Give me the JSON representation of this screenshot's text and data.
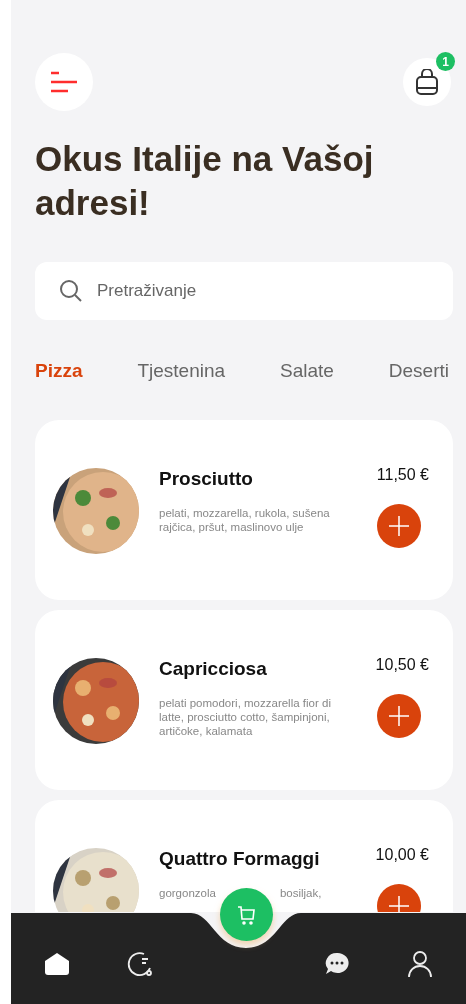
{
  "header": {
    "cart_count": "1"
  },
  "title": "Okus Italije na Vašoj adresi!",
  "search": {
    "placeholder": "Pretraživanje"
  },
  "tabs": [
    {
      "label": "Pizza",
      "selected": true
    },
    {
      "label": "Tjestenina",
      "selected": false
    },
    {
      "label": "Salate",
      "selected": false
    },
    {
      "label": "Deserti",
      "selected": false
    }
  ],
  "products": [
    {
      "name": "Prosciutto",
      "price": "11,50 €",
      "description": "pelati, mozzarella, rukola, sušena rajčica, pršut, maslinovo ulje",
      "kind": "picture"
    },
    {
      "name": "Capricciosa",
      "price": "10,50 €",
      "description": "pelati pomodori, mozzarella fior di latte, prosciutto cotto, šampinjoni, artičoke, kalamata",
      "kind": "picture"
    },
    {
      "name": "Quattro Formaggi",
      "price": "10,00 €",
      "description": "gorgonzola",
      "description_tail": "bosiljak,",
      "kind": "picture"
    }
  ],
  "nav": [
    {
      "kind": "home",
      "selected": true
    },
    {
      "kind": "history",
      "selected": false
    },
    {
      "kind": "cart",
      "selected": false
    },
    {
      "kind": "chat",
      "selected": false
    },
    {
      "kind": "profile",
      "selected": false
    }
  ]
}
